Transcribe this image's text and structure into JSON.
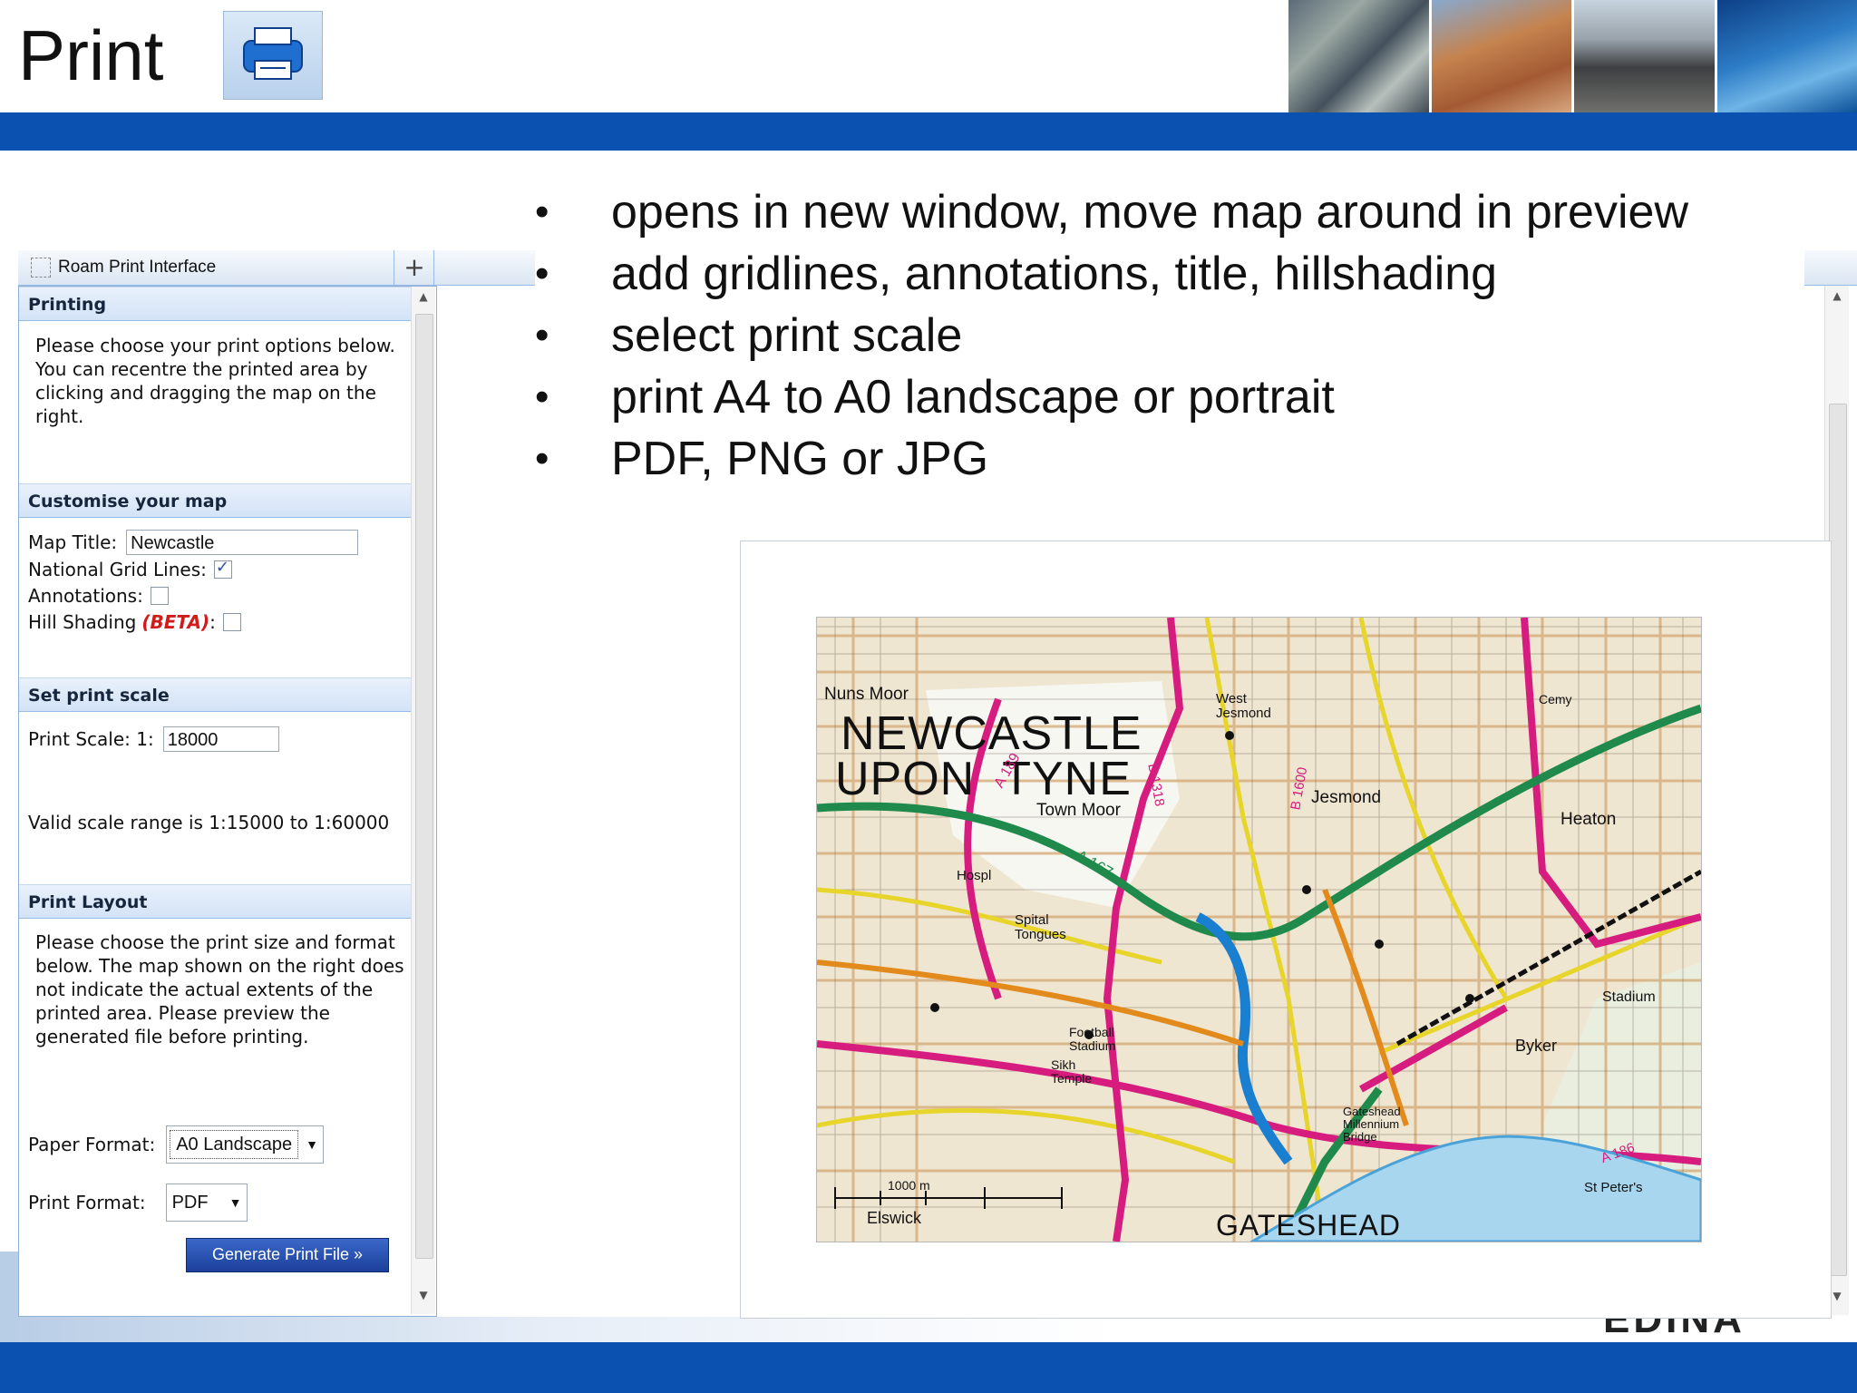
{
  "slide": {
    "title": "Print",
    "bullets": [
      "opens in new window, move map around in preview",
      "add gridlines, annotations, title, hillshading",
      "select print scale",
      "print A4 to A0 landscape or portrait",
      "PDF, PNG or JPG"
    ],
    "footer_logo": "EDINA",
    "colors": {
      "bar": "#0a51b0",
      "panel_header": "#d3e3f7",
      "beta": "#d21b1b"
    }
  },
  "app": {
    "tab_label": "Roam Print Interface",
    "add_tab_label": "+",
    "icons": {
      "print": "printer-icon",
      "tab": "dashed-square-icon",
      "checkbox": "checkmark-icon"
    }
  },
  "panel": {
    "printing": {
      "header": "Printing",
      "text": "Please choose your print options below. You can recentre the printed area by clicking and dragging the map on the right."
    },
    "customise": {
      "header": "Customise your map",
      "map_title_label": "Map Title:",
      "map_title_value": "Newcastle",
      "grid_lines_label": "National Grid Lines:",
      "grid_lines_checked": true,
      "annotations_label": "Annotations:",
      "annotations_checked": false,
      "hill_shading_label": "Hill Shading",
      "hill_shading_beta": "(BETA)",
      "hill_shading_colon": ":",
      "hill_shading_checked": false
    },
    "scale": {
      "header": "Set print scale",
      "label": "Print Scale: 1:",
      "value": "18000",
      "valid_range": "Valid scale range is 1:15000 to 1:60000"
    },
    "layout": {
      "header": "Print Layout",
      "text": "Please choose the print size and format below. The map shown on the right does not indicate the actual extents of the printed area. Please preview the generated file before printing.",
      "paper_format_label": "Paper Format:",
      "paper_format_value": "A0 Landscape",
      "print_format_label": "Print Format:",
      "print_format_value": "PDF",
      "generate_button": "Generate Print File »"
    }
  },
  "map": {
    "labels": {
      "nuns_moor": "Nuns Moor",
      "city_line1": "NEWCASTLE",
      "city_line2": "UPON  TYNE",
      "town_moor": "Town Moor",
      "jesmond": "Jesmond",
      "west_jesmond": "West Jesmond",
      "heaton": "Heaton",
      "byker": "Byker",
      "stadium": "Stadium",
      "elswick": "Elswick",
      "gateshead": "GATESHEAD",
      "st_peters": "St Peter's",
      "spital_tongues": "Spital Tongues",
      "hospl": "Hospl",
      "cemy": "Cemy",
      "football_stadium": "Football Stadium",
      "sikh_temple": "Sikh Temple",
      "gateshead_bridge": "Gateshead Millennium Bridge",
      "a189": "A 189",
      "a167": "A 167",
      "a186": "A 186",
      "b1318": "B 1318",
      "b1600": "B 1600",
      "scale_bar": "1000 m"
    }
  }
}
